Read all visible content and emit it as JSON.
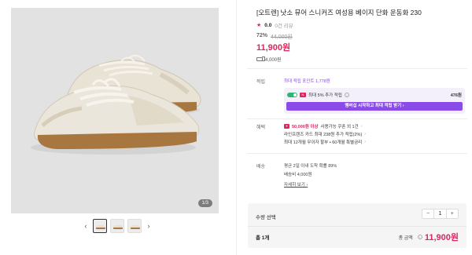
{
  "gallery": {
    "counter": "1/3",
    "prev_arrow": "‹",
    "next_arrow": "›",
    "thumbnail_count": 3
  },
  "product": {
    "title": "[오트렌] 낫소 뮤어 스니커즈 여성용 베이지 단화 운동화 230",
    "rating": "0.0",
    "reviews": "0건 리뷰",
    "discount": "72%",
    "original_price": "44,000원",
    "price": "11,900원",
    "shipping_fee": "4,000원"
  },
  "benefits": {
    "label": "적립",
    "max_points": "최대 적립 포인트 1,778원",
    "point_row_text": "최대 5% 추가 적립",
    "point_row_value": "476원",
    "join_button": "멤버십 시작하고 최대 적립 받기 ›"
  },
  "card": {
    "label": "혜택",
    "line1_strong": "50,000원 이상",
    "line1_rest": "사용가능 쿠폰 외 1건",
    "line2": "라인프렌즈 카드 최대 238원 추가 적립(2%)",
    "line3": "최대 12개월 무이자 할부 • 60개월 특별금리"
  },
  "delivery": {
    "label": "배송",
    "line1": "평균 2일 이내 도착 확률 89%",
    "line2": "배송비 4,000원",
    "detail_link": "자세히 보기 ›"
  },
  "order": {
    "qty_label": "수량 선택",
    "minus": "−",
    "qty": "1",
    "plus": "+",
    "total_count": "총 1개",
    "total_label": "총 금액",
    "total_amount": "11,900원"
  },
  "colors": {
    "accent": "#e0245e",
    "purple": "#8a4be8",
    "green": "#2bb673"
  }
}
